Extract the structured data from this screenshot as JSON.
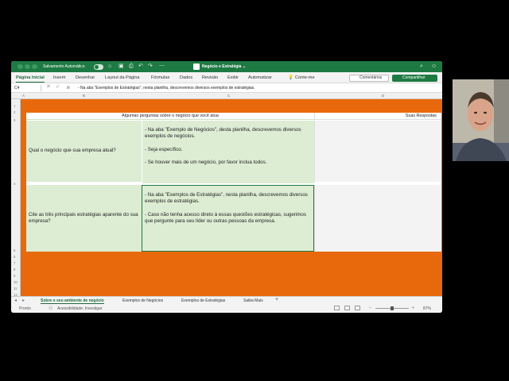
{
  "titlebar": {
    "autosave_label": "Salvamento Automático",
    "doc_title": "Negócio e Estratégia ⌄",
    "colors": {
      "bar": "#1e7a43"
    }
  },
  "ribbon": {
    "tabs": [
      "Página Inicial",
      "Inserir",
      "Desenhar",
      "Layout da Página",
      "Fórmulas",
      "Dados",
      "Revisão",
      "Exibir",
      "Automatizar"
    ],
    "tell_me": "Conte-me",
    "comments": "Comentários",
    "share": "Compartilhar"
  },
  "formula_bar": {
    "name_box": "C4",
    "fx": "fx",
    "content": "- Na aba \"Exemplos de Estratégias\", nesta planilha, descrevemos diversos exemplos de estratégias."
  },
  "grid": {
    "columns": [
      "A",
      "B",
      "C",
      "D"
    ],
    "rows": [
      "1",
      "2",
      "3",
      "4",
      "5",
      "6",
      "7",
      "8",
      "9",
      "10",
      "11",
      "12"
    ],
    "header_main": "Algumas perguntas sobre o negócio que você atua",
    "header_answers": "Suas Respostas",
    "rows_data": [
      {
        "question": "Qual o negócio que sua empresa atual?",
        "description": [
          "- Na aba \"Exemplo de Negócios\", desta planilha, descrevemos diversos exemplos de negócios.",
          "- Seja específico.",
          "- Se houver mais de um negócio, por favor inclua todos."
        ]
      },
      {
        "question": "Cite as três principais estratégias aparente do sua empresa?",
        "description": [
          "- Na aba \"Exemplos de Estratégias\", nesta planilha, descrevemos diversos exemplos de estratégias.",
          "- Caso não tenha acesso direto à essas questões estratégicas, sugerimos que pergunte para seu líder ou outras pessoas da empresa."
        ]
      }
    ],
    "colors": {
      "background": "#e8690b",
      "question_fill": "#dcedd3"
    }
  },
  "sheets": {
    "tabs": [
      "Sobre o seu ambiente de negócio",
      "Exemplos de Negócios",
      "Exemplos de Estratégias",
      "Saiba Mais"
    ],
    "active_index": 0,
    "add": "+"
  },
  "status": {
    "ready": "Pronto",
    "accessibility": "Acessibilidade: Investigar",
    "zoom": "87%"
  }
}
